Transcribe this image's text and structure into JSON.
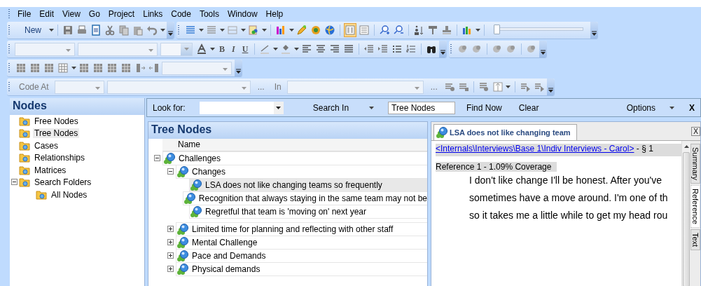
{
  "menu": [
    "File",
    "Edit",
    "View",
    "Go",
    "Project",
    "Links",
    "Code",
    "Tools",
    "Window",
    "Help"
  ],
  "toolbars": {
    "new_button": "New",
    "bold": "B",
    "italic": "I",
    "underline": "U",
    "zoom_slider": {
      "level": 0.03
    },
    "code_at_label": "Code At",
    "ellipsis_1": "...",
    "in_label": "In",
    "ellipsis_2": "..."
  },
  "navigation": {
    "title": "Nodes",
    "items": [
      {
        "label": "Free Nodes",
        "selected": false
      },
      {
        "label": "Tree Nodes",
        "selected": true
      },
      {
        "label": "Cases",
        "selected": false
      },
      {
        "label": "Relationships",
        "selected": false
      },
      {
        "label": "Matrices",
        "selected": false
      },
      {
        "label": "Search Folders",
        "selected": false,
        "expanded": true,
        "children": [
          {
            "label": "All Nodes",
            "selected": false
          }
        ]
      }
    ]
  },
  "search_bar": {
    "look_for_label": "Look for:",
    "search_in": "Search In",
    "search_in_value": "Tree Nodes",
    "find_now": "Find Now",
    "clear": "Clear",
    "options": "Options",
    "close": "X"
  },
  "tree_panel": {
    "title": "Tree Nodes",
    "column": "Name",
    "nodes": [
      {
        "label": "Challenges",
        "selected": false,
        "expanded": true,
        "children": [
          {
            "label": "Changes",
            "selected": false,
            "expanded": true,
            "children": [
              {
                "label": "LSA does not like changing teams so frequently",
                "selected": true
              },
              {
                "label": "Recognition that always staying in the same team may not be",
                "selected": false
              },
              {
                "label": "Regretful that team is 'moving on' next year",
                "selected": false
              }
            ]
          },
          {
            "label": "Limited time for planning and reflecting with other staff",
            "selected": false,
            "expanded": false
          },
          {
            "label": "Mental Challenge",
            "selected": false,
            "expanded": false
          },
          {
            "label": "Pace and Demands",
            "selected": false,
            "expanded": false
          },
          {
            "label": "Physical demands",
            "selected": false,
            "expanded": false
          }
        ]
      }
    ]
  },
  "detail": {
    "tab": "LSA does not like changing team",
    "close": "X",
    "source_link": "<Internals\\Interviews\\Base 1\\Indiv Interviews - Carol>",
    "source_suffix": " - § 1",
    "reference": "Reference 1 - 1.09% Coverage",
    "lines": [
      "I don't like change I'll be honest.  After you've",
      "sometimes have a move around.  I'm one of th",
      "so it takes me a little while to get my head rou"
    ],
    "side_tabs": [
      {
        "label": "Summary",
        "selected": false
      },
      {
        "label": "Reference",
        "selected": true
      },
      {
        "label": "Text",
        "selected": false
      }
    ]
  }
}
